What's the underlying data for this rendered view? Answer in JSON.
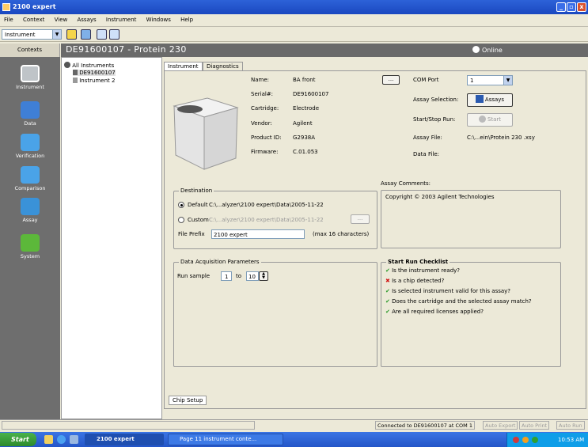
{
  "window": {
    "title": "2100 expert",
    "min": "_",
    "max": "▫",
    "close": "x"
  },
  "menu": [
    "File",
    "Context",
    "View",
    "Assays",
    "Instrument",
    "Windows",
    "Help"
  ],
  "toolbar": {
    "context_select": "Instrument"
  },
  "sidebar": {
    "header": "Contexts",
    "items": [
      {
        "label": "Instrument",
        "icon": "instrument-icon",
        "color": "#bfc4c8"
      },
      {
        "label": "Data",
        "icon": "data-icon",
        "color": "#3f7fd6"
      },
      {
        "label": "Verification",
        "icon": "verification-icon",
        "color": "#4aa3e8"
      },
      {
        "label": "Comparison",
        "icon": "comparison-icon",
        "color": "#4aa3e8"
      },
      {
        "label": "Assay",
        "icon": "assay-icon",
        "color": "#3a92d8"
      },
      {
        "label": "System",
        "icon": "system-icon",
        "color": "#5cb83a"
      }
    ]
  },
  "header": {
    "title": "DE91600107 - Protein 230",
    "status": "Online"
  },
  "tree": {
    "root": "All Instruments",
    "children": [
      "DE91600107",
      "Instrument 2"
    ]
  },
  "tabs": {
    "instrument": "Instrument",
    "diagnostics": "Diagnostics",
    "chip_setup": "Chip Setup"
  },
  "info": {
    "name_label": "Name:",
    "name": "BA front",
    "serial_label": "Serial#:",
    "serial": "DE91600107",
    "cartridge_label": "Cartridge:",
    "cartridge": "Electrode",
    "vendor_label": "Vendor:",
    "vendor": "Agilent",
    "product_label": "Product ID:",
    "product": "G2938A",
    "firmware_label": "Firmware:",
    "firmware": "C.01.053",
    "ellipsis": "..."
  },
  "right": {
    "com_label": "COM Port",
    "com_value": "1",
    "assay_sel_label": "Assay Selection:",
    "assays_btn": "Assays",
    "start_label": "Start/Stop Run:",
    "start_btn": "Start",
    "assay_file_label": "Assay File:",
    "assay_file": "C:\\...ein\\Protein 230 .xsy",
    "data_file_label": "Data File:"
  },
  "destination": {
    "title": "Destination",
    "default_label": "Default",
    "default_path": "C:\\...alyzer\\2100 expert\\Data\\2005-11-22",
    "custom_label": "Custom",
    "custom_path": "C:\\...alyzer\\2100 expert\\Data\\2005-11-22",
    "browse": "...",
    "prefix_label": "File Prefix",
    "prefix_value": "2100 expert",
    "prefix_hint": "(max 16 characters)"
  },
  "comments": {
    "title": "Assay Comments:",
    "text": "Copyright © 2003 Agilent Technologies"
  },
  "acquisition": {
    "title": "Data Acquisition Parameters",
    "run_label": "Run sample",
    "from": "1",
    "to_label": "to",
    "to": "10"
  },
  "checklist": {
    "title": "Start Run Checklist",
    "items": [
      {
        "ok": true,
        "mark": "✔",
        "text": "Is the instrument ready?"
      },
      {
        "ok": false,
        "mark": "✖",
        "text": "Is a chip detected?"
      },
      {
        "ok": true,
        "mark": "✔",
        "text": "Is selected instrument valid for this assay?"
      },
      {
        "ok": true,
        "mark": "✔",
        "text": "Does the cartridge and the selected assay match?"
      },
      {
        "ok": true,
        "mark": "✔",
        "text": "Are all required licenses applied?"
      }
    ]
  },
  "status": {
    "connected": "Connected to DE91600107 at COM 1",
    "auto_export": "Auto Export",
    "auto_print": "Auto Print",
    "auto_run": "Auto Run"
  },
  "taskbar": {
    "start": "Start",
    "task1": "2100 expert",
    "task2": "Page 11 instrument conte...",
    "time": "10:53 AM"
  }
}
